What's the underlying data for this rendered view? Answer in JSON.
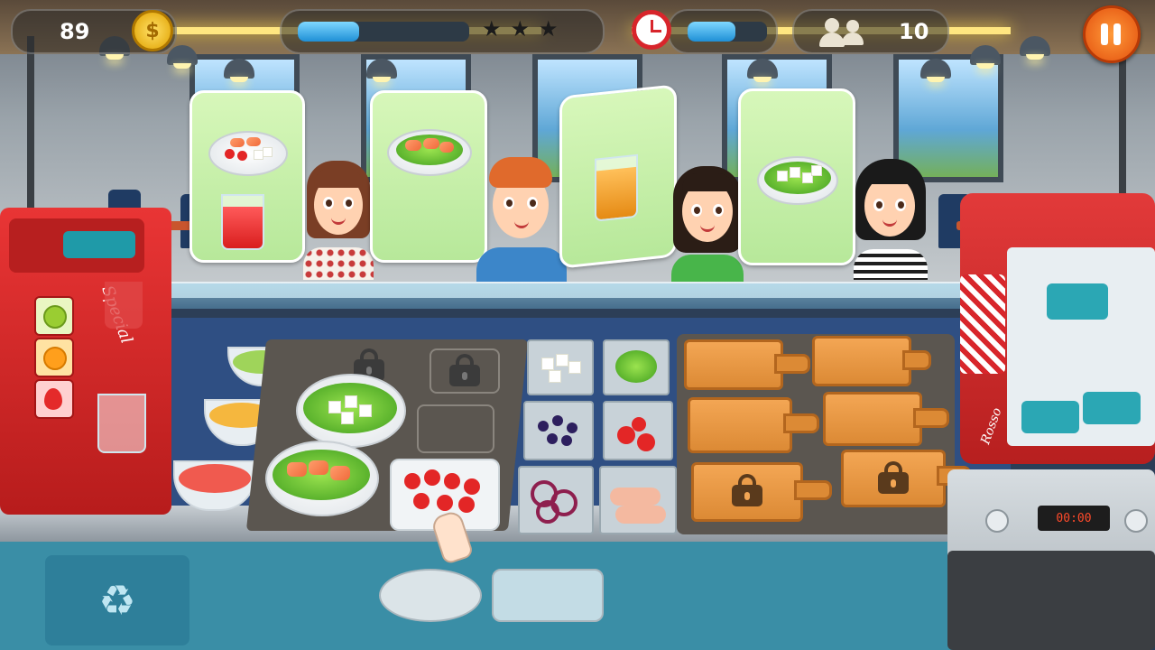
{
  "hud": {
    "coins": "89",
    "coin_symbol": "$",
    "progress_fraction": 0.36,
    "stars_total": 3,
    "stars_earned": 0,
    "time_fraction": 0.6,
    "customers_left": "10"
  },
  "orders": [
    {
      "customer": "brown-bob-woman",
      "items": [
        "salmon-tomato-feta-salad",
        "strawberry-juice"
      ]
    },
    {
      "customer": "redhead-man",
      "items": [
        "salmon-salad"
      ]
    },
    {
      "customer": "dark-hair-woman",
      "items": [
        "orange-juice"
      ]
    },
    {
      "customer": "black-bob-woman",
      "items": [
        "feta-salad"
      ]
    }
  ],
  "oven": {
    "display": "00:00"
  },
  "fridge": {
    "label": "Rosso"
  },
  "juicer": {
    "label": "Special"
  },
  "colors": {
    "counter": "#2f4f83",
    "bubble": "#c9f0a8",
    "board": "#e8953f",
    "accent_orange": "#e3500e",
    "machine_red": "#d12a2a"
  }
}
